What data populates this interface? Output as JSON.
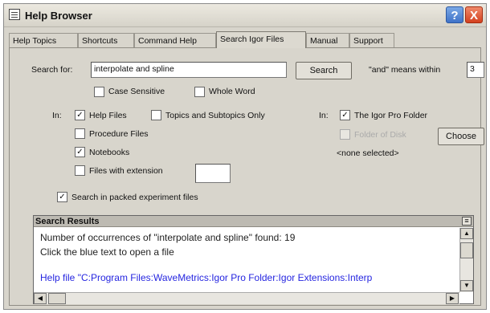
{
  "window": {
    "title": "Help Browser",
    "help_glyph": "?",
    "close_glyph": "X"
  },
  "tabs": [
    "Help Topics",
    "Shortcuts",
    "Command Help",
    "Search Igor Files",
    "Manual",
    "Support"
  ],
  "active_tab": "Search Igor Files",
  "search": {
    "label": "Search for:",
    "value": "interpolate and spline",
    "button": "Search",
    "and_label": "\"and\" means within",
    "and_value": "3",
    "case_sensitive": "Case Sensitive",
    "whole_word": "Whole Word"
  },
  "in_files": {
    "in_label": "In:",
    "help_files": "Help Files",
    "topics_only": "Topics and Subtopics Only",
    "procedure_files": "Procedure Files",
    "notebooks": "Notebooks",
    "files_with_ext": "Files with extension",
    "ext_value": ""
  },
  "in_folder": {
    "in_label": "In:",
    "igor_folder": "The Igor Pro Folder",
    "disabled_option": "Folder of Disk",
    "choose": "Choose",
    "selection": "<none selected>"
  },
  "packed": "Search in packed experiment files",
  "checked": {
    "help_files": true,
    "notebooks": true,
    "igor_folder": true,
    "packed": true
  },
  "results": {
    "header": "Search Results",
    "menu_glyph": "≡",
    "line1": "Number of occurrences of \"interpolate and spline\" found: 19",
    "line2": "Click the blue text to open a file",
    "line3": "Help file \"C:Program Files:WaveMetrics:Igor Pro Folder:Igor Extensions:Interp"
  },
  "scroll": {
    "up": "▲",
    "down": "▼",
    "left": "◀",
    "right": "▶"
  },
  "check_mark": "✓",
  "colors": {
    "link": "#2525e0",
    "close": "#d3401e",
    "help": "#3f72c8"
  }
}
